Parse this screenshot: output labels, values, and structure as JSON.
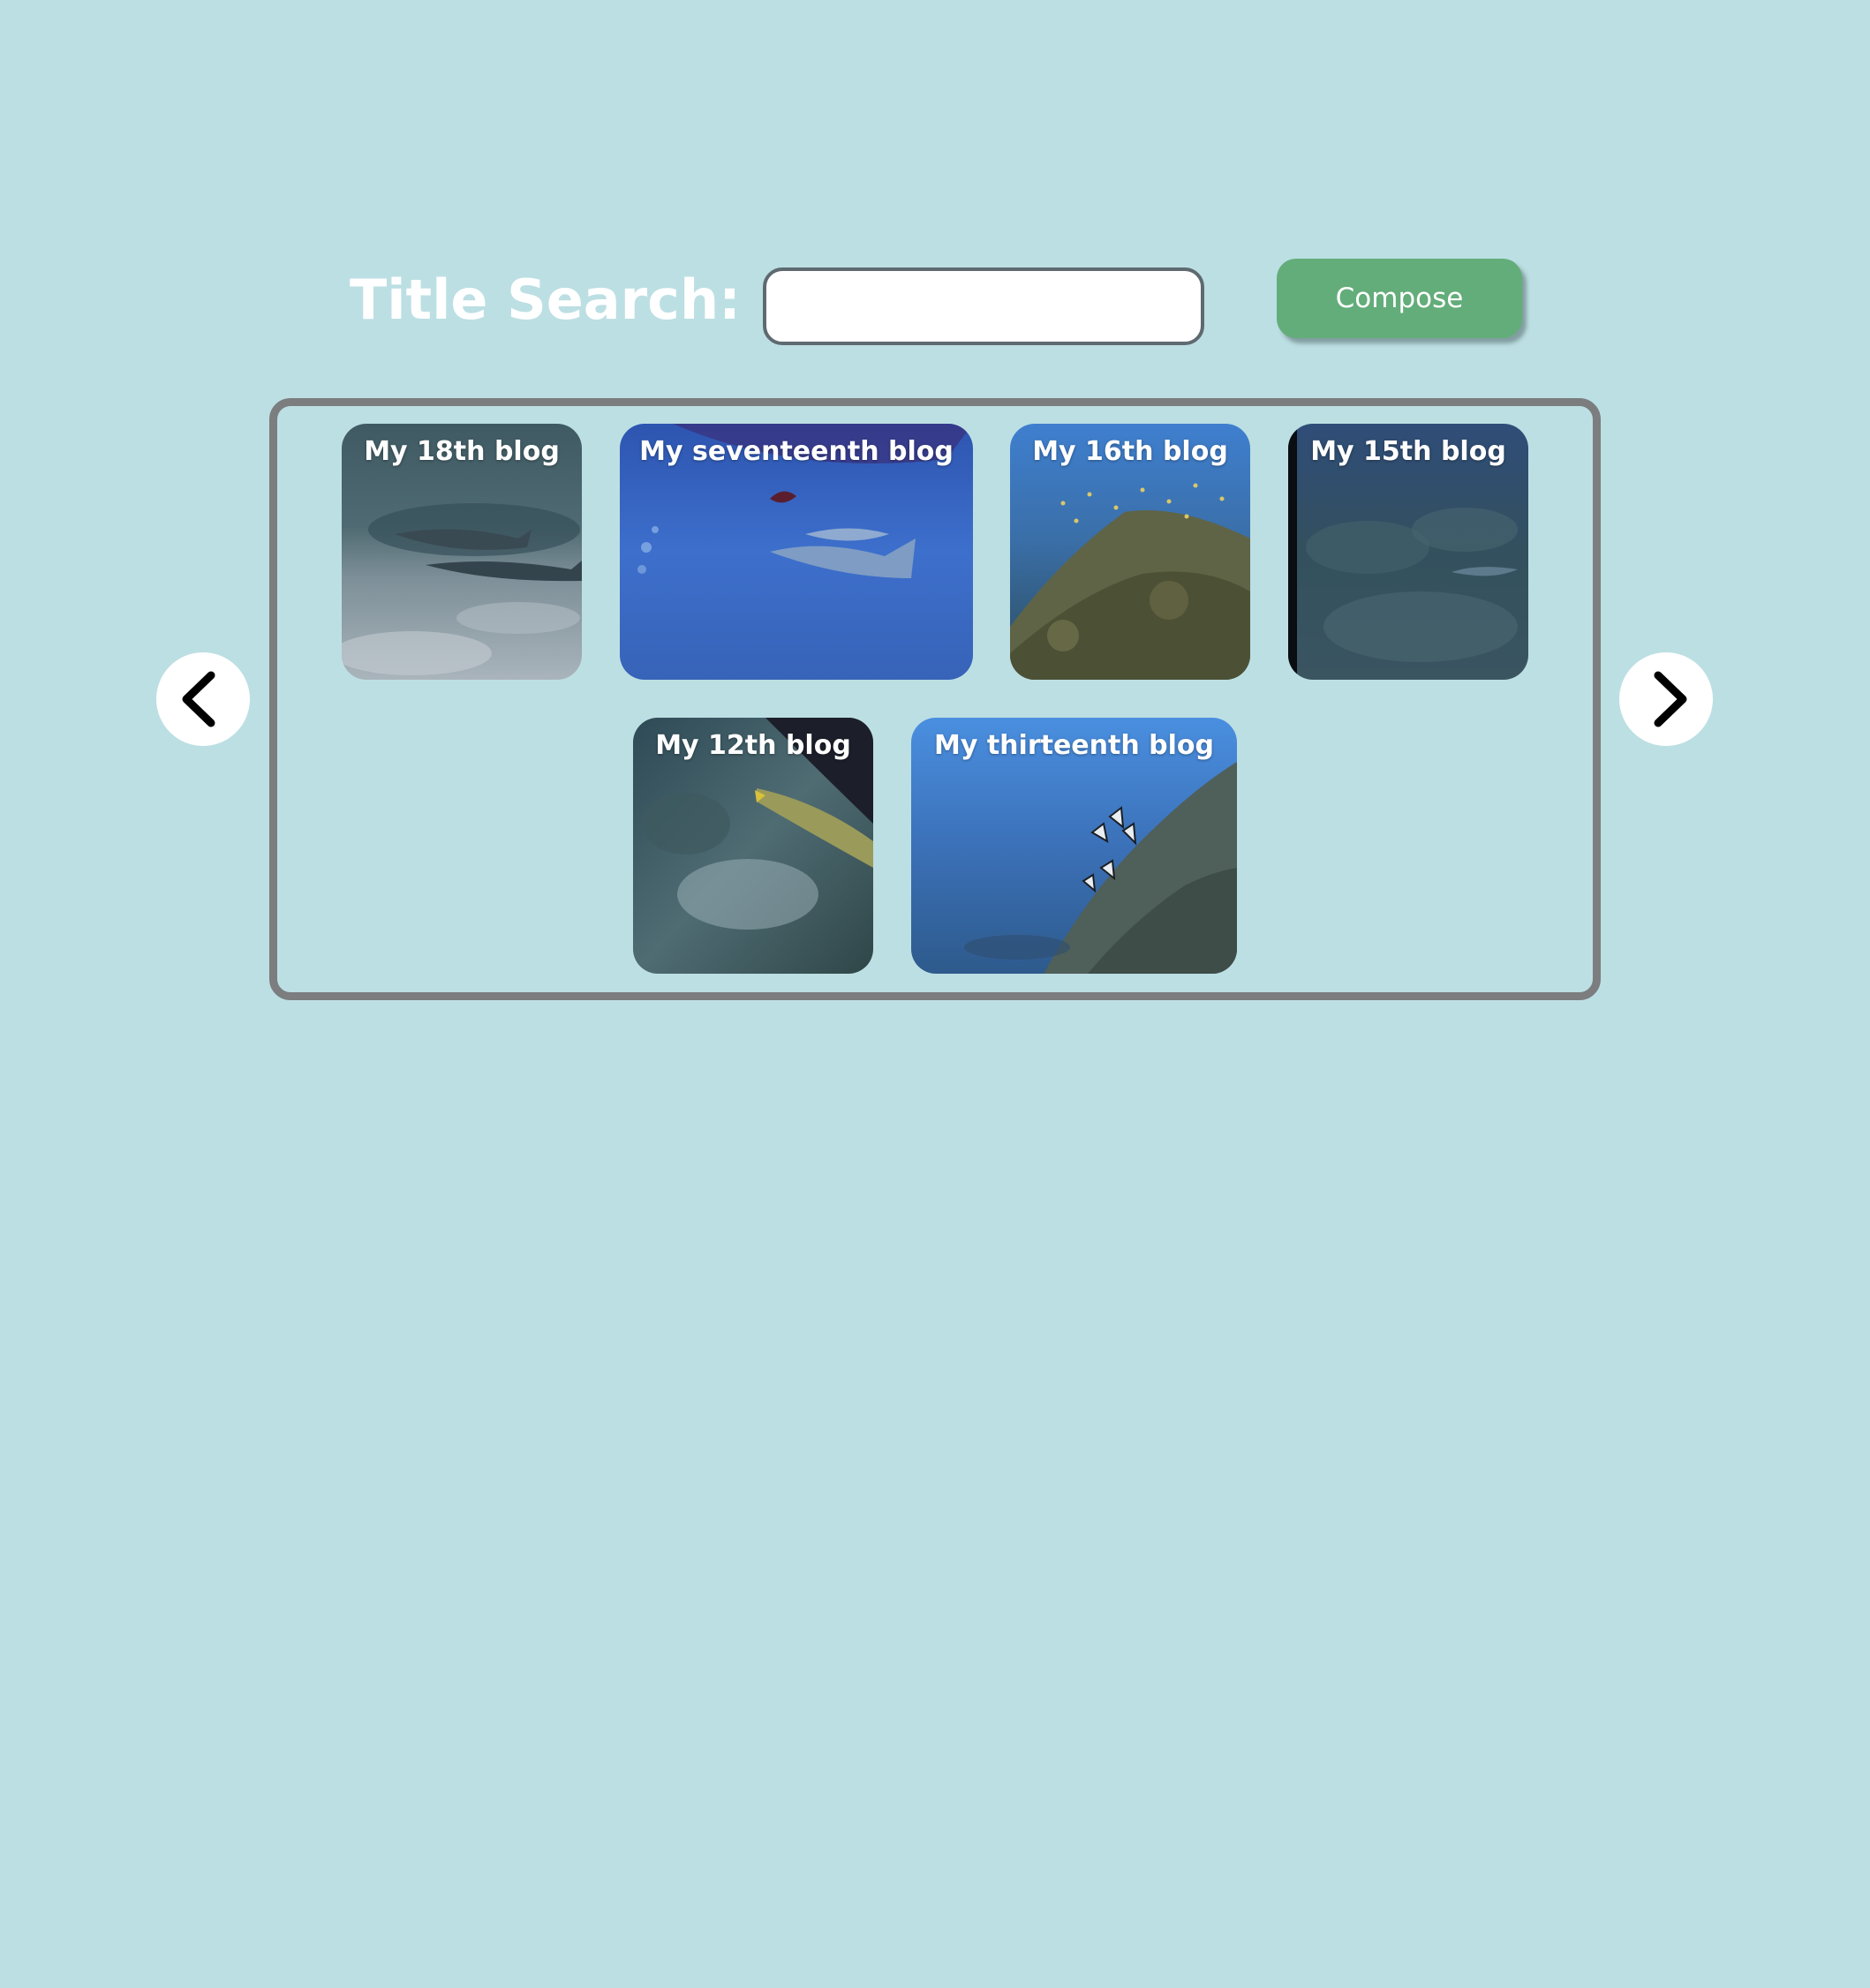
{
  "header": {
    "title_search_label": "Title Search:",
    "search_placeholder": "",
    "compose_label": "Compose"
  },
  "colors": {
    "background": "#bcdfe3",
    "compose_button": "#63ad7a",
    "carousel_border": "#7b7d7f"
  },
  "carousel": {
    "prev_icon": "chevron-left-icon",
    "next_icon": "chevron-right-icon",
    "cards": [
      {
        "title": "My 18th blog",
        "scene": "sharks resting on sandy seafloor"
      },
      {
        "title": "My seventeenth blog",
        "scene": "fish swimming in open blue water"
      },
      {
        "title": "My 16th blog",
        "scene": "coral reef with school of small fish"
      },
      {
        "title": "My 15th blog",
        "scene": "dark rocky reef"
      },
      {
        "title": "My 12th blog",
        "scene": "yellow fish over rocky reef"
      },
      {
        "title": "My thirteenth blog",
        "scene": "bannerfish beside reef in blue water"
      }
    ]
  }
}
